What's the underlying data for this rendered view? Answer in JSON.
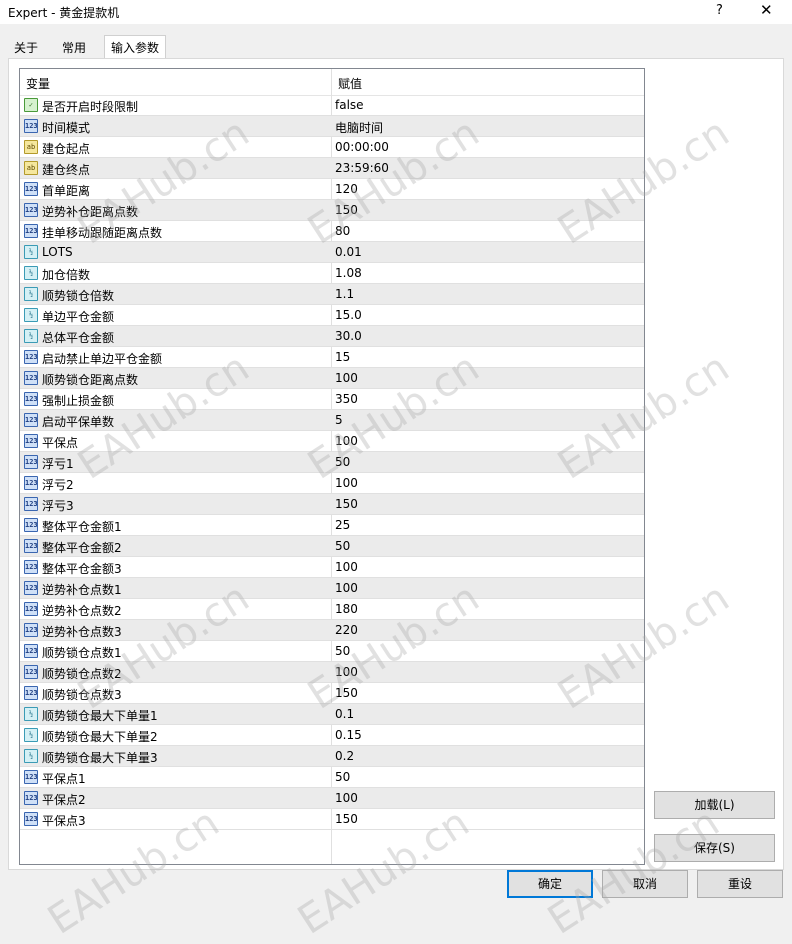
{
  "window": {
    "title": "Expert - 黄金提款机",
    "help_glyph": "?",
    "close_glyph": "✕"
  },
  "tabs": [
    {
      "label": "关于"
    },
    {
      "label": "常用"
    },
    {
      "label": "输入参数"
    }
  ],
  "table": {
    "col_variable": "变量",
    "col_value": "赋值",
    "rows": [
      {
        "icon": "bool",
        "icon_text": "✓",
        "name": "是否开启时段限制",
        "value": "false"
      },
      {
        "icon": "num",
        "icon_text": "123",
        "name": "时间模式",
        "value": "电脑时间"
      },
      {
        "icon": "str",
        "icon_text": "ab",
        "name": "建仓起点",
        "value": "00:00:00"
      },
      {
        "icon": "str",
        "icon_text": "ab",
        "name": "建仓终点",
        "value": "23:59:60"
      },
      {
        "icon": "num",
        "icon_text": "123",
        "name": "首单距离",
        "value": "120"
      },
      {
        "icon": "num",
        "icon_text": "123",
        "name": "逆势补仓距离点数",
        "value": "150"
      },
      {
        "icon": "num",
        "icon_text": "123",
        "name": "挂单移动跟随距离点数",
        "value": "80"
      },
      {
        "icon": "dbl",
        "icon_text": "½",
        "name": "LOTS",
        "value": "0.01"
      },
      {
        "icon": "dbl",
        "icon_text": "½",
        "name": "加仓倍数",
        "value": "1.08"
      },
      {
        "icon": "dbl",
        "icon_text": "½",
        "name": "顺势锁仓倍数",
        "value": "1.1"
      },
      {
        "icon": "dbl",
        "icon_text": "½",
        "name": "单边平仓金额",
        "value": "15.0"
      },
      {
        "icon": "dbl",
        "icon_text": "½",
        "name": "总体平仓金额",
        "value": "30.0"
      },
      {
        "icon": "num",
        "icon_text": "123",
        "name": "启动禁止单边平仓金额",
        "value": "15"
      },
      {
        "icon": "num",
        "icon_text": "123",
        "name": "顺势锁仓距离点数",
        "value": "100"
      },
      {
        "icon": "num",
        "icon_text": "123",
        "name": "强制止损金额",
        "value": "350"
      },
      {
        "icon": "num",
        "icon_text": "123",
        "name": "启动平保单数",
        "value": "5"
      },
      {
        "icon": "num",
        "icon_text": "123",
        "name": "平保点",
        "value": "100"
      },
      {
        "icon": "num",
        "icon_text": "123",
        "name": "浮亏1",
        "value": "50"
      },
      {
        "icon": "num",
        "icon_text": "123",
        "name": "浮亏2",
        "value": "100"
      },
      {
        "icon": "num",
        "icon_text": "123",
        "name": "浮亏3",
        "value": "150"
      },
      {
        "icon": "num",
        "icon_text": "123",
        "name": "整体平仓金额1",
        "value": "25"
      },
      {
        "icon": "num",
        "icon_text": "123",
        "name": "整体平仓金额2",
        "value": "50"
      },
      {
        "icon": "num",
        "icon_text": "123",
        "name": "整体平仓金额3",
        "value": "100"
      },
      {
        "icon": "num",
        "icon_text": "123",
        "name": "逆势补仓点数1",
        "value": "100"
      },
      {
        "icon": "num",
        "icon_text": "123",
        "name": "逆势补仓点数2",
        "value": "180"
      },
      {
        "icon": "num",
        "icon_text": "123",
        "name": "逆势补仓点数3",
        "value": "220"
      },
      {
        "icon": "num",
        "icon_text": "123",
        "name": "顺势锁仓点数1",
        "value": "50"
      },
      {
        "icon": "num",
        "icon_text": "123",
        "name": "顺势锁仓点数2",
        "value": "100"
      },
      {
        "icon": "num",
        "icon_text": "123",
        "name": "顺势锁仓点数3",
        "value": "150"
      },
      {
        "icon": "dbl",
        "icon_text": "½",
        "name": "顺势锁仓最大下单量1",
        "value": "0.1"
      },
      {
        "icon": "dbl",
        "icon_text": "½",
        "name": "顺势锁仓最大下单量2",
        "value": "0.15"
      },
      {
        "icon": "dbl",
        "icon_text": "½",
        "name": "顺势锁仓最大下单量3",
        "value": "0.2"
      },
      {
        "icon": "num",
        "icon_text": "123",
        "name": "平保点1",
        "value": "50"
      },
      {
        "icon": "num",
        "icon_text": "123",
        "name": "平保点2",
        "value": "100"
      },
      {
        "icon": "num",
        "icon_text": "123",
        "name": "平保点3",
        "value": "150"
      }
    ]
  },
  "buttons": {
    "load": "加载(L)",
    "save": "保存(S)",
    "ok": "确定",
    "cancel": "取消",
    "reset": "重设"
  },
  "watermark": "EAHub.cn"
}
